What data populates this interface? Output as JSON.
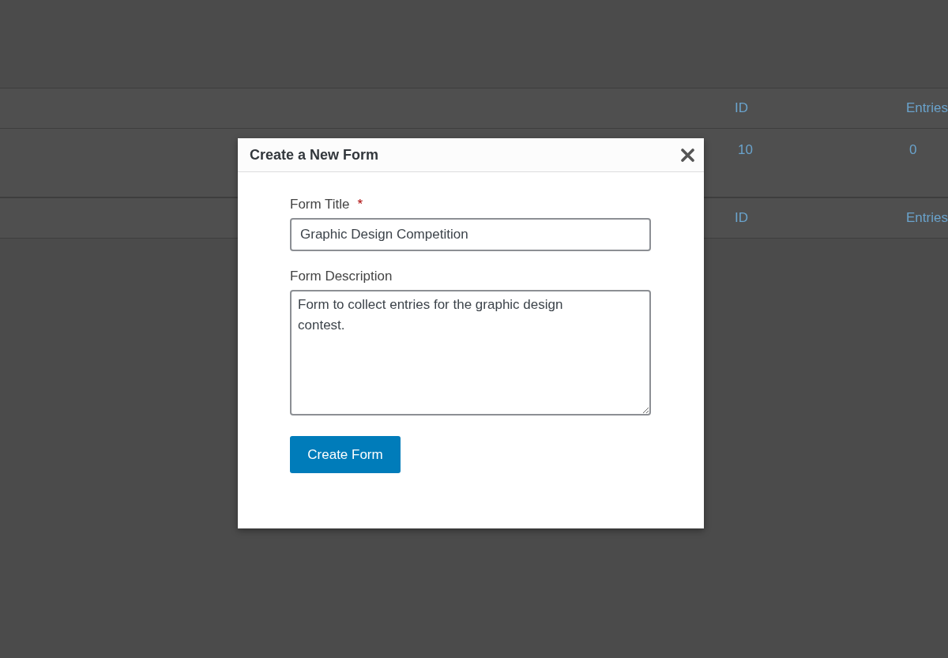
{
  "table": {
    "columns": [
      "ID",
      "Entries"
    ],
    "rows": [
      {
        "id": "10",
        "entries": "0"
      }
    ],
    "footer_columns": [
      "ID",
      "Entries"
    ]
  },
  "modal": {
    "title": "Create a New Form",
    "fields": [
      {
        "kind": "text",
        "label": "Form Title",
        "required_mark": "*",
        "value": "Graphic Design Competition"
      },
      {
        "kind": "textarea",
        "label": "Form Description",
        "value": "Form to collect entries for the graphic design contest."
      }
    ],
    "submit": "Create Form"
  }
}
